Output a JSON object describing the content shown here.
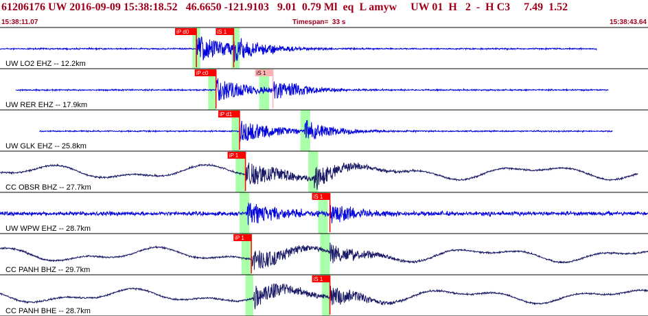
{
  "header": {
    "title": "61206176 UW 2016-09-09 15:38:18.52   46.6650 -121.9103   9.01  0.79 Ml  eq  L amyw     UW 01  H   2  -  H C3     7.49  1.52",
    "start_time": "15:38:11.07",
    "timespan": "Timespan=  33 s",
    "end_time": "15:38:43.64"
  },
  "colors": {
    "header_text": "#a0001a",
    "pick_red": "#ff0000",
    "pick_light": "#ffb0b0",
    "window_green": "#aaffaa",
    "trace_blue": "#0000dd",
    "trace_navy": "#1a1a66"
  },
  "chart_data": {
    "type": "line",
    "x_units": "seconds",
    "xlim": [
      0,
      33
    ],
    "channels": [
      {
        "label": "UW LO2 EHZ -- 12.2km",
        "color": "#0000dd",
        "style": "quiet",
        "data_span": [
          0.0,
          30.4
        ],
        "p_arrival": 10.0,
        "s_arrival": 11.9,
        "amplitude": 1.0,
        "picks": [
          {
            "label": "iP d0",
            "t": 10.0,
            "style": "red"
          },
          {
            "label": "iS 1",
            "t": 11.9,
            "style": "red"
          }
        ],
        "windows": [
          [
            9.8,
            10.2
          ],
          [
            11.8,
            12.2
          ]
        ]
      },
      {
        "label": "UW RER EHZ -- 17.9km",
        "color": "#0000dd",
        "style": "quiet",
        "data_span": [
          0.8,
          31.0
        ],
        "p_arrival": 11.0,
        "s_arrival": 13.9,
        "amplitude": 0.9,
        "picks": [
          {
            "label": "iP c0",
            "t": 11.0,
            "style": "red"
          },
          {
            "label": "iS 1",
            "t": 13.9,
            "style": "light"
          }
        ],
        "windows": [
          [
            10.6,
            11.0
          ],
          [
            13.2,
            13.7
          ]
        ]
      },
      {
        "label": "UW GLK EHZ -- 25.8km",
        "color": "#0000dd",
        "style": "quiet",
        "data_span": [
          2.0,
          31.2
        ],
        "p_arrival": 12.2,
        "s_arrival": 15.5,
        "amplitude": 0.85,
        "picks": [
          {
            "label": "iP d1",
            "t": 12.2,
            "style": "red"
          }
        ],
        "windows": [
          [
            11.8,
            12.2
          ],
          [
            15.3,
            15.8
          ]
        ]
      },
      {
        "label": "CC OBSR BHZ -- 27.7km",
        "color": "#1a1a66",
        "style": "wavy",
        "data_span": [
          0.0,
          32.5
        ],
        "p_arrival": 12.5,
        "s_arrival": 16.0,
        "amplitude": 1.0,
        "picks": [
          {
            "label": "iP 1",
            "t": 12.5,
            "style": "red"
          }
        ],
        "windows": [
          [
            12.0,
            12.5
          ],
          [
            15.7,
            16.2
          ]
        ]
      },
      {
        "label": "UW WPW EHZ -- 28.7km",
        "color": "#0000dd",
        "style": "noisy",
        "data_span": [
          0.0,
          33.0
        ],
        "p_arrival": 12.6,
        "s_arrival": 16.8,
        "amplitude": 0.9,
        "picks": [
          {
            "label": "iS 1",
            "t": 16.8,
            "style": "red"
          }
        ],
        "windows": [
          [
            12.2,
            12.7
          ],
          [
            16.2,
            16.7
          ]
        ]
      },
      {
        "label": "CC PANH BHZ -- 29.7km",
        "color": "#1a1a66",
        "style": "wavy",
        "data_span": [
          0.0,
          33.0
        ],
        "p_arrival": 12.8,
        "s_arrival": 16.8,
        "amplitude": 0.9,
        "picks": [
          {
            "label": "iP 1",
            "t": 12.8,
            "style": "red"
          }
        ],
        "windows": [
          [
            12.3,
            12.8
          ],
          [
            16.3,
            16.8
          ]
        ]
      },
      {
        "label": "CC PANH BHE -- 28.7km",
        "color": "#1a1a66",
        "style": "wavy",
        "data_span": [
          0.0,
          33.0
        ],
        "p_arrival": 12.9,
        "s_arrival": 16.8,
        "amplitude": 0.9,
        "picks": [
          {
            "label": "iS 1",
            "t": 16.8,
            "style": "red"
          }
        ],
        "windows": [
          [
            12.5,
            12.9
          ],
          [
            16.4,
            16.8
          ]
        ]
      }
    ]
  }
}
